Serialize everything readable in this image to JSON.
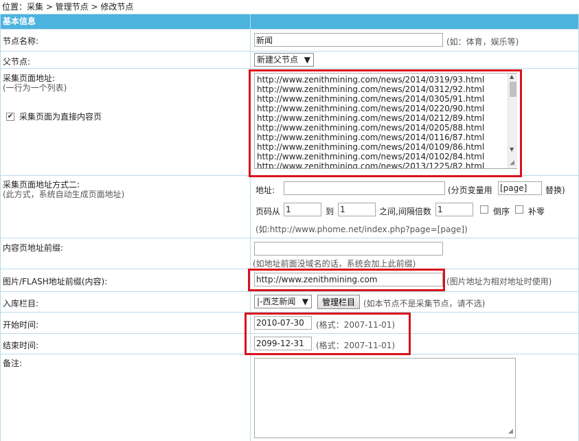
{
  "breadcrumb": "位置：采集 > 管理节点 > 修改节点",
  "section_title": "基本信息",
  "node_name": {
    "label": "节点名称:",
    "value": "新闻",
    "hint": "(如：体育，娱乐等)"
  },
  "parent_node": {
    "label": "父节点:",
    "value": "新建父节点"
  },
  "collect_url": {
    "label": "采集页面地址:",
    "sublabel": "(一行为一个列表)",
    "checkbox_label": "采集页面为直接内容页",
    "checkbox_checked": true,
    "urls": "http://www.zenithmining.com/news/2014/0319/93.html\nhttp://www.zenithmining.com/news/2014/0312/92.html\nhttp://www.zenithmining.com/news/2014/0305/91.html\nhttp://www.zenithmining.com/news/2014/0220/90.html\nhttp://www.zenithmining.com/news/2014/0212/89.html\nhttp://www.zenithmining.com/news/2014/0205/88.html\nhttp://www.zenithmining.com/news/2014/0116/87.html\nhttp://www.zenithmining.com/news/2014/0109/86.html\nhttp://www.zenithmining.com/news/2014/0102/84.html\nhttp://www.zenithmining.com/news/2013/1225/82.html"
  },
  "collect_url_2": {
    "label": "采集页面地址方式二:",
    "sublabel": "(此方式，系统自动生成页面地址)",
    "address_label": "地址:",
    "address_value": "",
    "page_var_prefix": "(分页变量用",
    "page_var": "[page]",
    "page_var_suffix": "替换)",
    "page_from_label": "页码从",
    "page_from": "1",
    "to_label": "到",
    "page_to": "1",
    "step_label": "之间,间隔倍数",
    "step": "1",
    "reverse_label": "倒序",
    "pad_zero_label": "补零",
    "example": "(如:http://www.phome.net/index.php?page=[page])"
  },
  "content_prefix": {
    "label": "内容页地址前缀:",
    "value": "",
    "hint": "(如地址前面没域名的话，系统会加上此前缀)"
  },
  "image_prefix": {
    "label": "图片/FLASH地址前缀(内容):",
    "value": "http://www.zenithmining.com",
    "hint": "(图片地址为相对地址时使用)"
  },
  "column": {
    "label": "入库栏目:",
    "value": "|-西芝新闻",
    "manage_button": "管理栏目",
    "hint": "(如本节点不是采集节点，请不选)"
  },
  "start_time": {
    "label": "开始时间:",
    "value": "2010-07-30",
    "hint": "(格式：2007-11-01)"
  },
  "end_time": {
    "label": "结束时间:",
    "value": "2099-12-31",
    "hint": "(格式：2007-11-01)"
  },
  "remark": {
    "label": "备注:",
    "value": ""
  },
  "colors": {
    "header_bg": "#4cb3de",
    "border": "#b9dbea",
    "highlight": "#d9111b"
  }
}
